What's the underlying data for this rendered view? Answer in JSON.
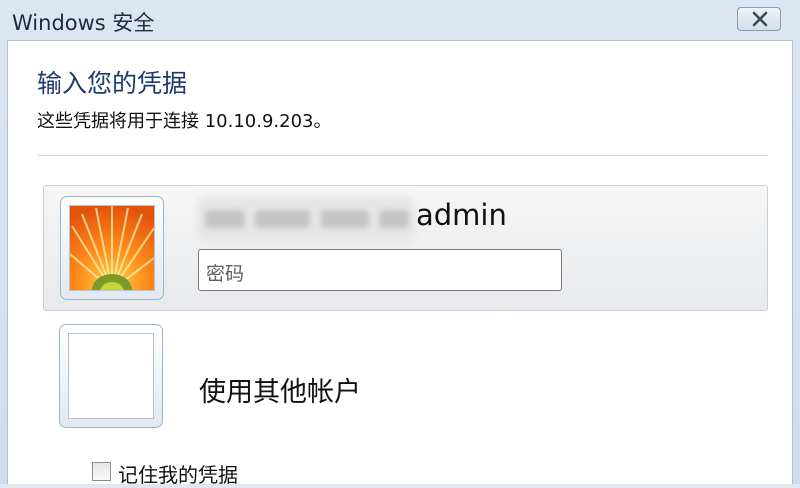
{
  "window": {
    "title": "Windows 安全",
    "close_icon": "close-icon"
  },
  "dialog": {
    "heading": "输入您的凭据",
    "subtitle": "这些凭据将用于连接 10.10.9.203。"
  },
  "credential_tiles": [
    {
      "username_visible": "admin",
      "password_placeholder": "密码",
      "avatar_icon": "orange-flower-avatar-icon",
      "selected": true
    },
    {
      "label": "使用其他帐户",
      "avatar_icon": "blank-user-avatar-icon",
      "selected": false
    }
  ],
  "remember": {
    "label": "记住我的凭据",
    "checked": false
  },
  "colors": {
    "heading": "#1e3a6e",
    "titlebar": "#dce6f2",
    "selected_tile": "#e7e9ec"
  }
}
